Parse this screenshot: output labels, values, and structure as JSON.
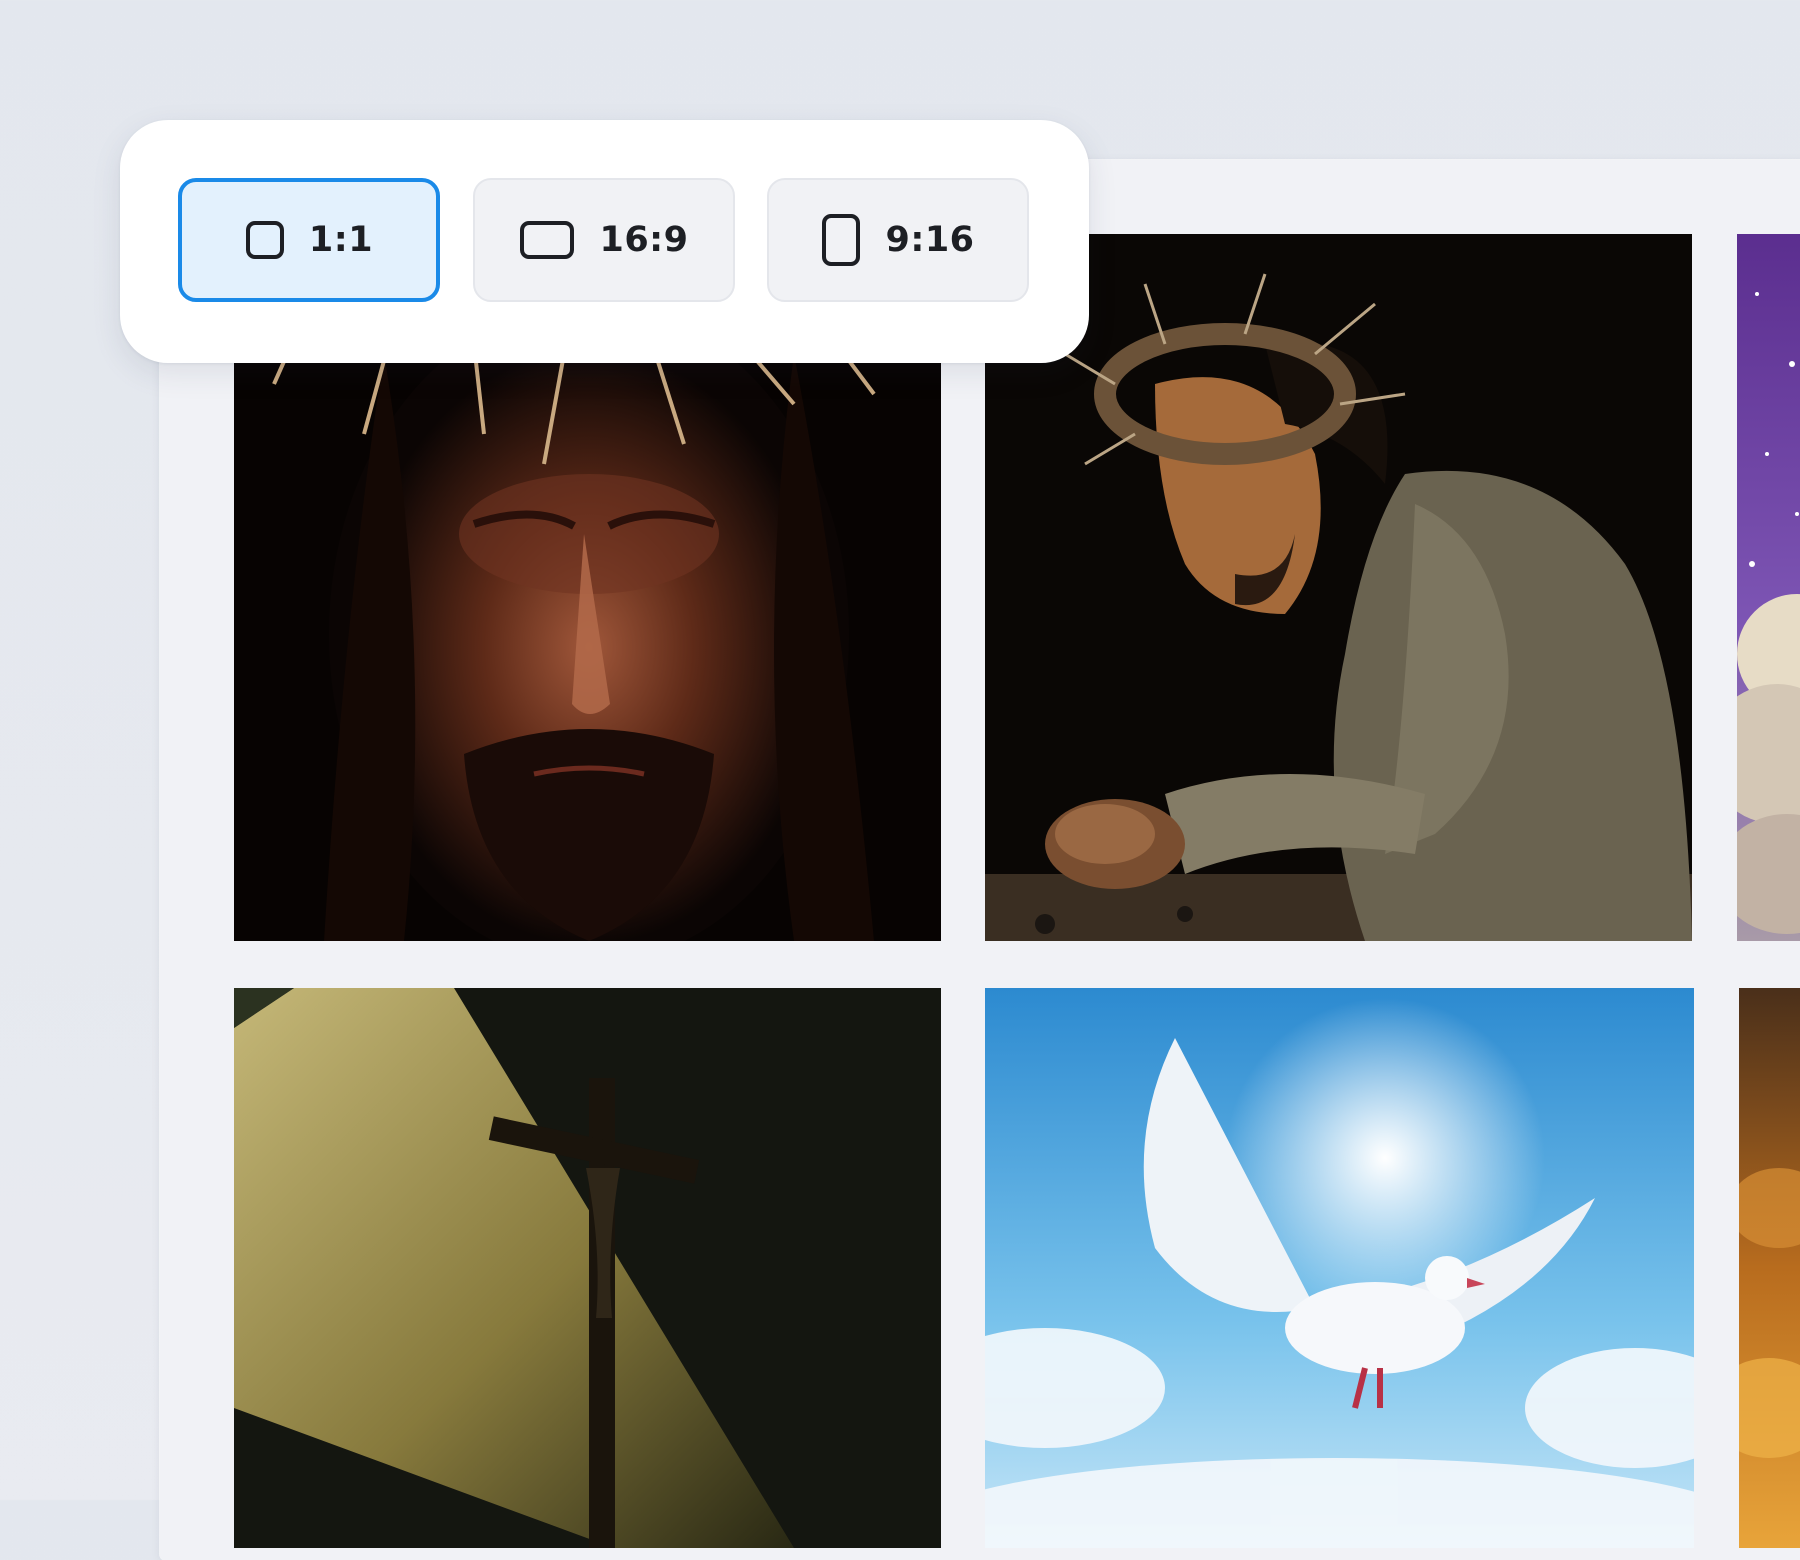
{
  "aspect_ratio_selector": {
    "selected": "1:1",
    "options": [
      {
        "label": "1:1",
        "icon": "square-icon"
      },
      {
        "label": "16:9",
        "icon": "landscape-rectangle-icon"
      },
      {
        "label": "9:16",
        "icon": "portrait-rectangle-icon"
      }
    ],
    "accent_color": "#1a8ae8"
  },
  "gallery": {
    "images": [
      {
        "subject": "jesus-crown-of-thorns-portrait"
      },
      {
        "subject": "jesus-praying-kneeling"
      },
      {
        "subject": "starry-purple-sky-clouds"
      },
      {
        "subject": "crucifix-in-light-rays"
      },
      {
        "subject": "white-dove-in-blue-sky"
      },
      {
        "subject": "golden-sunset-clouds"
      }
    ]
  }
}
